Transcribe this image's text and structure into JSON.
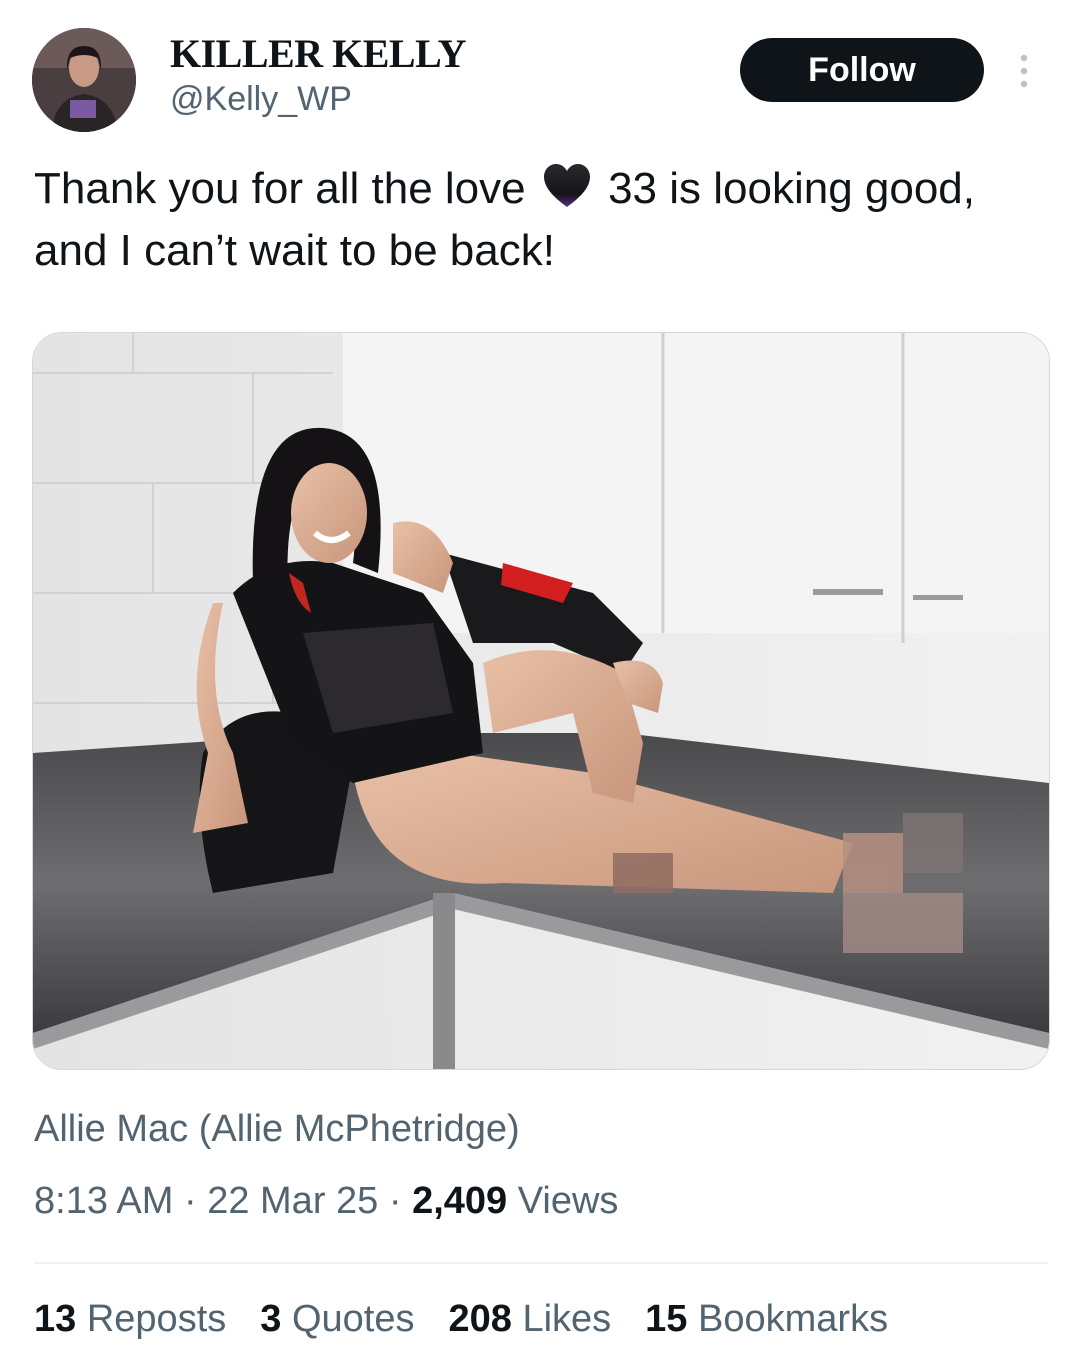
{
  "author": {
    "display_name": "KILLER KELLY",
    "handle": "@Kelly_WP"
  },
  "follow_button": {
    "label": "Follow"
  },
  "tweet": {
    "text_before": "Thank you for all the love",
    "text_after": " 33 is looking good, and I can’t wait to be back!",
    "emoji": "black-heart-icon",
    "photo_credit": "Allie Mac (Allie McPhetridge)"
  },
  "meta": {
    "time": "8:13 AM",
    "date": "22 Mar 25",
    "views_count": "2,409",
    "views_label": "Views",
    "separator": "·"
  },
  "stats": [
    {
      "count": "13",
      "label": "Reposts"
    },
    {
      "count": "3",
      "label": "Quotes"
    },
    {
      "count": "208",
      "label": "Likes"
    },
    {
      "count": "15",
      "label": "Bookmarks"
    }
  ],
  "colors": {
    "text_primary": "#0f1419",
    "text_secondary": "#536471",
    "button_bg": "#0f1419",
    "divider": "#eff3f4"
  }
}
